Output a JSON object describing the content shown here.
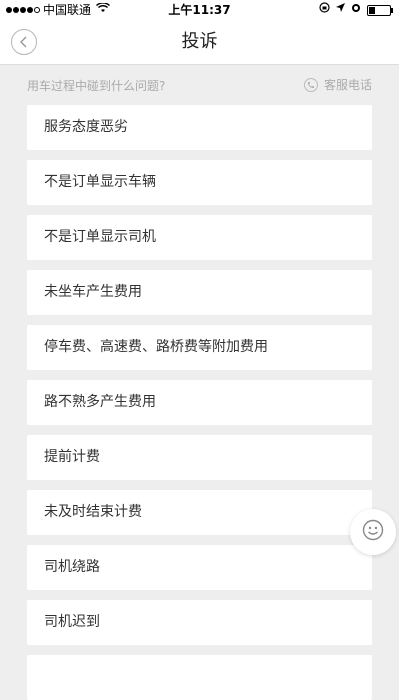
{
  "status_bar": {
    "carrier": "中国联通",
    "time": "上午11:37",
    "battery_level": 0.3
  },
  "nav": {
    "title": "投诉"
  },
  "subheader": {
    "prompt": "用车过程中碰到什么问题?",
    "service_label": "客服电话"
  },
  "complaints": [
    "服务态度恶劣",
    "不是订单显示车辆",
    "不是订单显示司机",
    "未坐车产生费用",
    "停车费、高速费、路桥费等附加费用",
    "路不熟多产生费用",
    "提前计费",
    "未及时结束计费",
    "司机绕路",
    "司机迟到",
    ""
  ],
  "icons": {
    "back": "chevron-left-icon",
    "phone": "phone-icon",
    "feedback": "smiley-icon"
  },
  "colors": {
    "background": "#eeeeee",
    "card": "#ffffff",
    "text": "#333333",
    "muted": "#aaaaaa"
  }
}
